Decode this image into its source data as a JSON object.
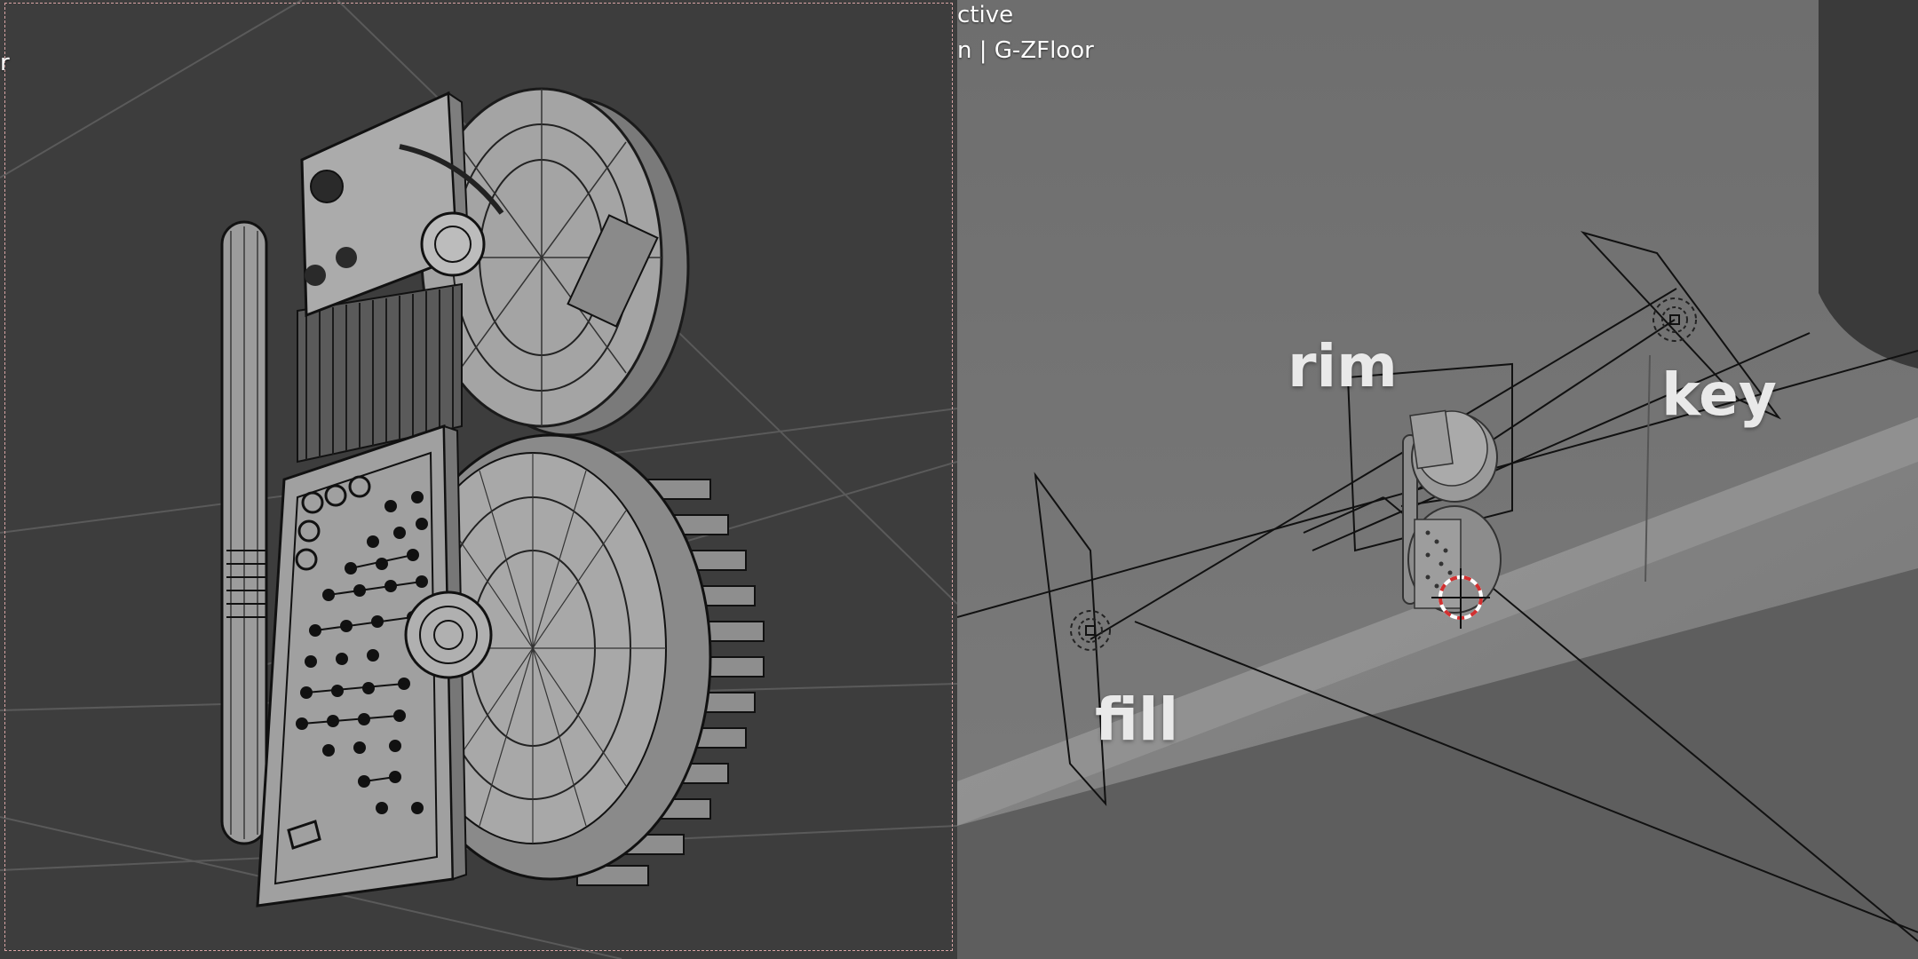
{
  "viewport_left": {
    "overlay_text": "r"
  },
  "viewport_right": {
    "header_line1": "ctive",
    "header_line2": "n | G-ZFloor",
    "light_labels": {
      "rim": "rim",
      "key": "key",
      "fill": "fill"
    }
  },
  "colors": {
    "left_bg": "#3d3d3d",
    "right_bg": "#6a6a6a",
    "wire": "#1a1a1a",
    "mesh_fill": "#9a9a9a",
    "cursor_red": "#d23030"
  }
}
